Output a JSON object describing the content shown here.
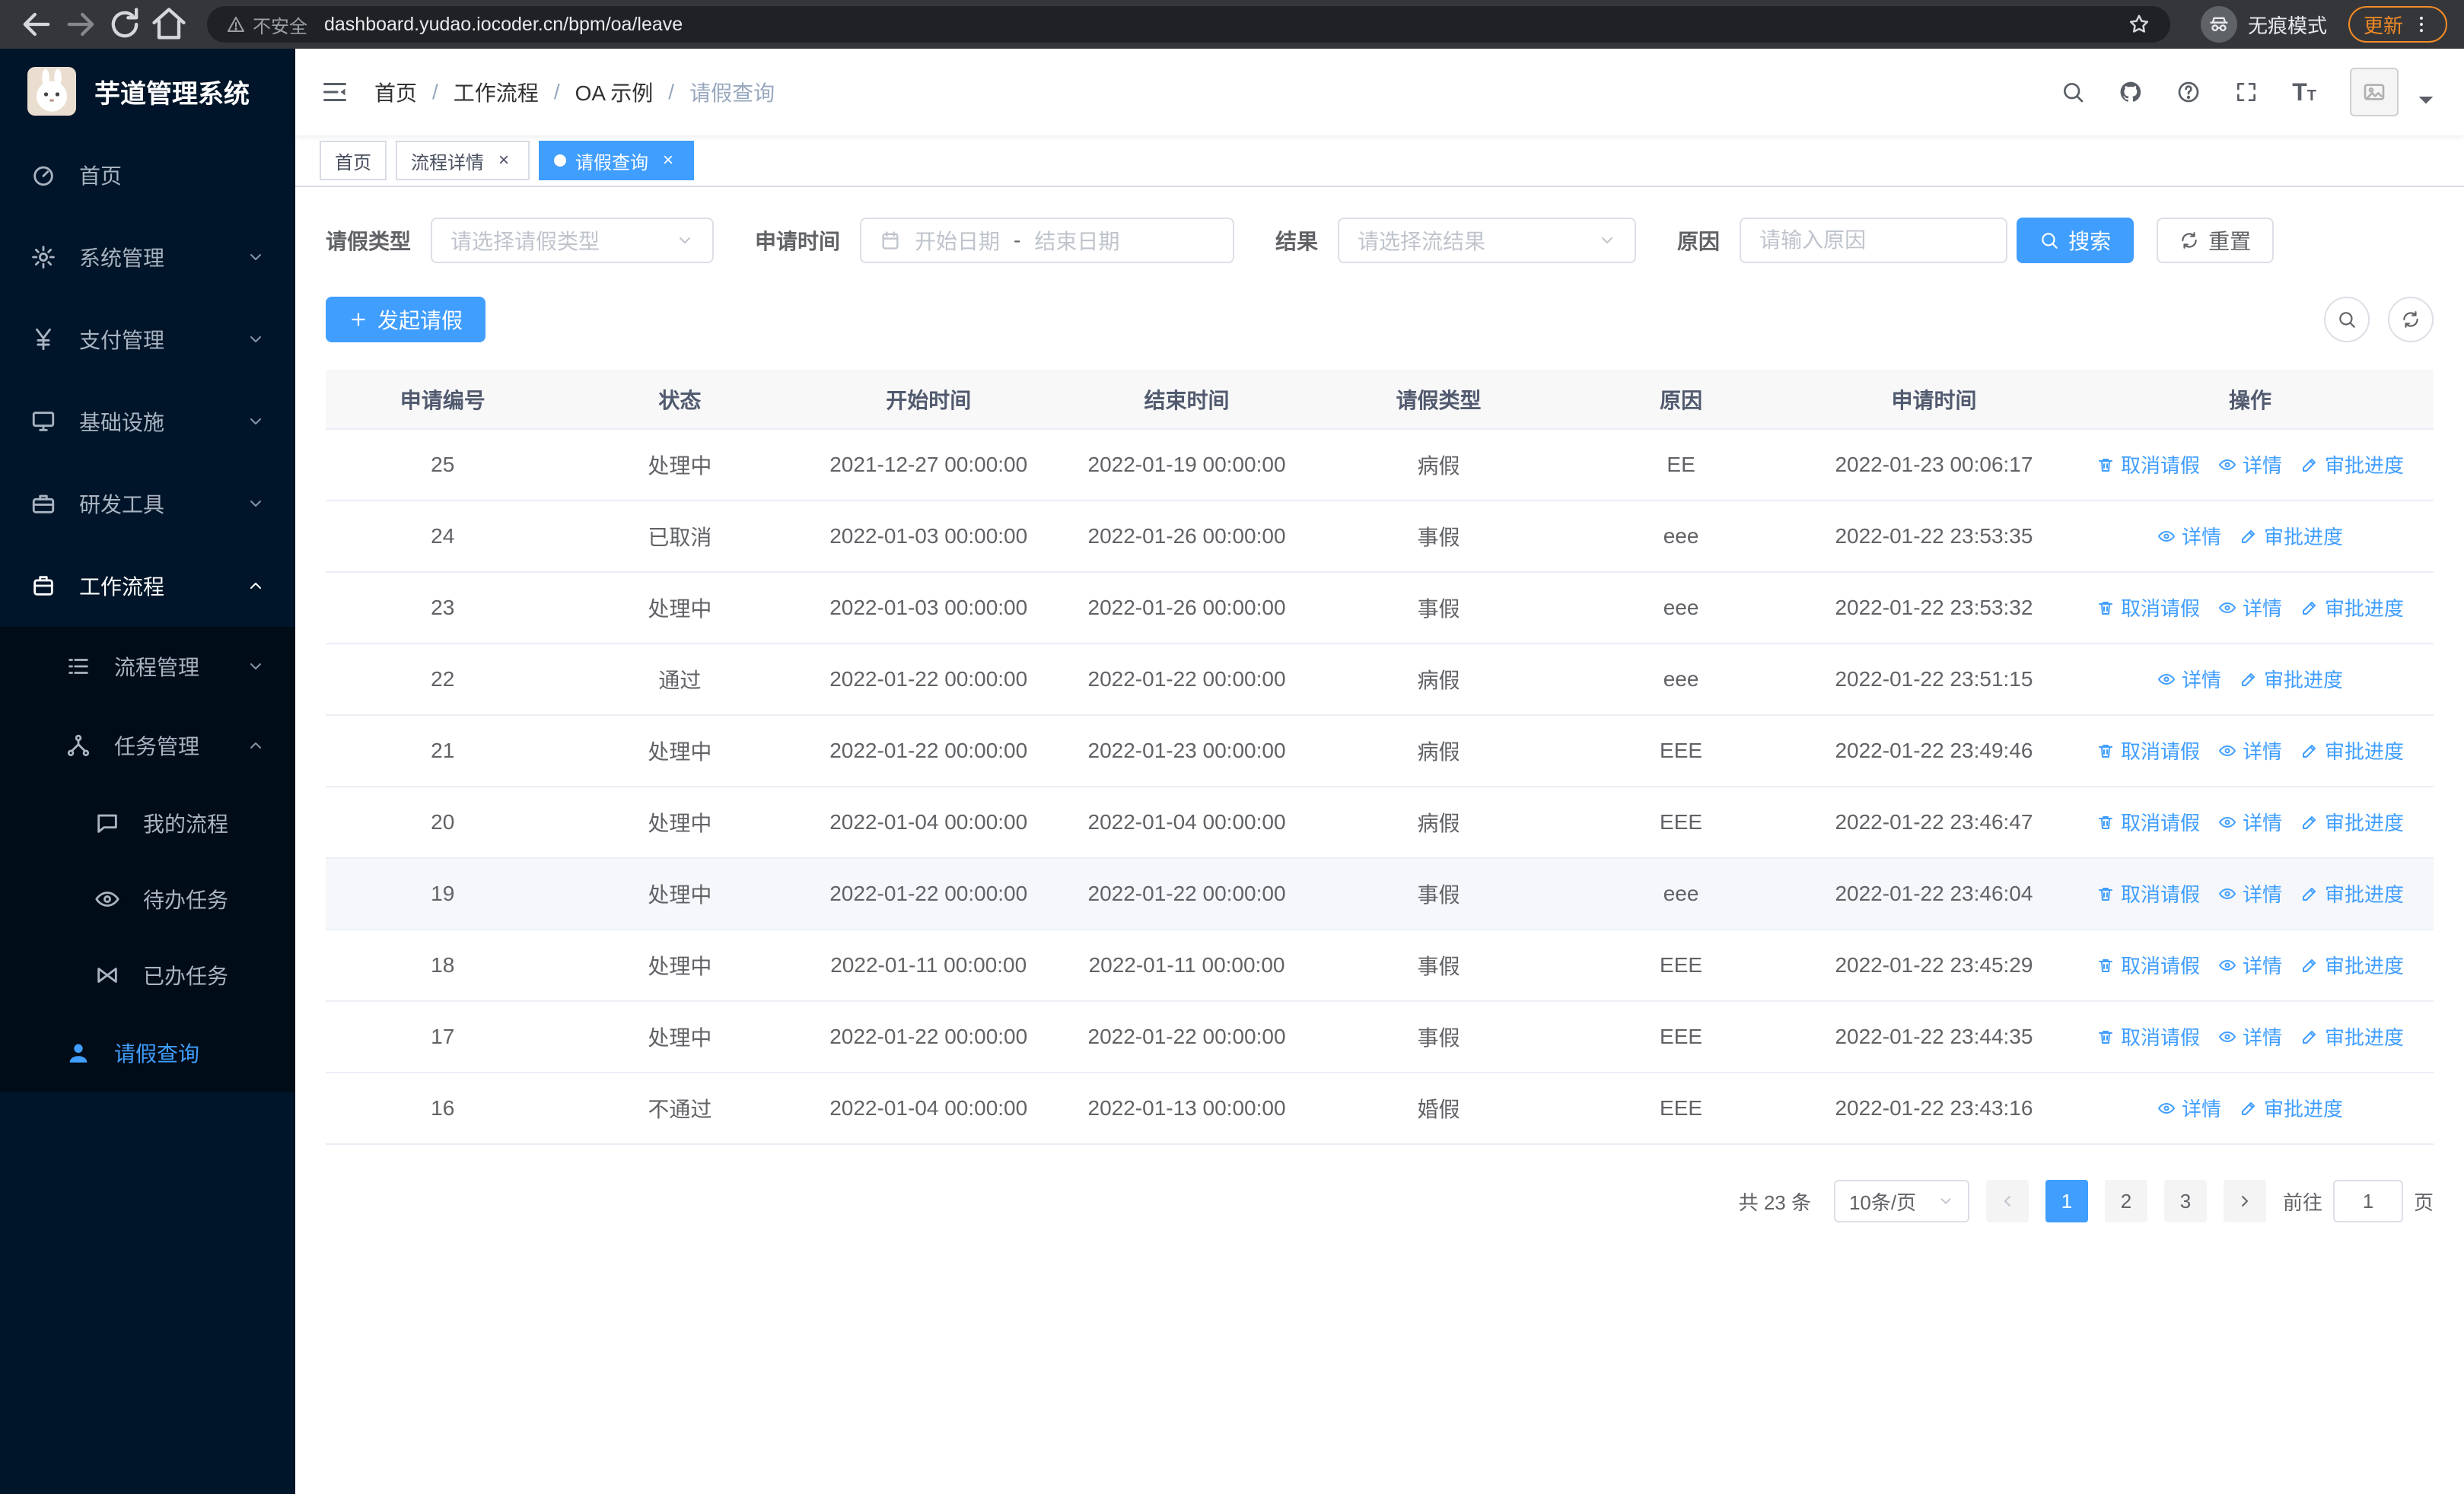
{
  "colors": {
    "accent": "#409eff",
    "sidebar_bg": "#001529",
    "submenu_bg": "#000c17",
    "update_orange": "#f28b25"
  },
  "browser": {
    "security_text": "不安全",
    "url": "dashboard.yudao.iocoder.cn/bpm/oa/leave",
    "incognito_label": "无痕模式",
    "update_label": "更新"
  },
  "sidebar": {
    "logo_title": "芋道管理系统",
    "items": [
      {
        "label": "首页"
      },
      {
        "label": "系统管理"
      },
      {
        "label": "支付管理"
      },
      {
        "label": "基础设施"
      },
      {
        "label": "研发工具"
      },
      {
        "label": "工作流程"
      }
    ],
    "workflow_children": [
      {
        "label": "流程管理"
      },
      {
        "label": "任务管理"
      }
    ],
    "task_children": [
      {
        "label": "我的流程"
      },
      {
        "label": "待办任务"
      },
      {
        "label": "已办任务"
      }
    ],
    "active_item": "请假查询"
  },
  "header": {
    "breadcrumb": [
      "首页",
      "工作流程",
      "OA 示例",
      "请假查询"
    ],
    "separator": "/"
  },
  "tabs": [
    {
      "label": "首页"
    },
    {
      "label": "流程详情"
    },
    {
      "label": "请假查询"
    }
  ],
  "filters": {
    "leave_type_label": "请假类型",
    "leave_type_placeholder": "请选择请假类型",
    "apply_time_label": "申请时间",
    "start_date_placeholder": "开始日期",
    "date_separator": "-",
    "end_date_placeholder": "结束日期",
    "result_label": "结果",
    "result_placeholder": "请选择流结果",
    "reason_label": "原因",
    "reason_placeholder": "请输入原因",
    "search_label": "搜索",
    "reset_label": "重置"
  },
  "toolbar": {
    "create_label": "发起请假"
  },
  "table": {
    "headers": [
      "申请编号",
      "状态",
      "开始时间",
      "结束时间",
      "请假类型",
      "原因",
      "申请时间",
      "操作"
    ],
    "action_defs": {
      "cancel": {
        "label": "取消请假",
        "icon": "trash",
        "name": "cancel-leave-link"
      },
      "detail": {
        "label": "详情",
        "icon": "eye",
        "name": "detail-link"
      },
      "progress": {
        "label": "审批进度",
        "icon": "edit",
        "name": "approval-progress-link"
      }
    },
    "rows": [
      {
        "id": "25",
        "status": "处理中",
        "start": "2021-12-27 00:00:00",
        "end": "2022-01-19 00:00:00",
        "type": "病假",
        "reason": "EE",
        "applied": "2022-01-23 00:06:17",
        "actions": [
          "cancel",
          "detail",
          "progress"
        ],
        "highlighted": false
      },
      {
        "id": "24",
        "status": "已取消",
        "start": "2022-01-03 00:00:00",
        "end": "2022-01-26 00:00:00",
        "type": "事假",
        "reason": "eee",
        "applied": "2022-01-22 23:53:35",
        "actions": [
          "detail",
          "progress"
        ],
        "highlighted": false
      },
      {
        "id": "23",
        "status": "处理中",
        "start": "2022-01-03 00:00:00",
        "end": "2022-01-26 00:00:00",
        "type": "事假",
        "reason": "eee",
        "applied": "2022-01-22 23:53:32",
        "actions": [
          "cancel",
          "detail",
          "progress"
        ],
        "highlighted": false
      },
      {
        "id": "22",
        "status": "通过",
        "start": "2022-01-22 00:00:00",
        "end": "2022-01-22 00:00:00",
        "type": "病假",
        "reason": "eee",
        "applied": "2022-01-22 23:51:15",
        "actions": [
          "detail",
          "progress"
        ],
        "highlighted": false
      },
      {
        "id": "21",
        "status": "处理中",
        "start": "2022-01-22 00:00:00",
        "end": "2022-01-23 00:00:00",
        "type": "病假",
        "reason": "EEE",
        "applied": "2022-01-22 23:49:46",
        "actions": [
          "cancel",
          "detail",
          "progress"
        ],
        "highlighted": false
      },
      {
        "id": "20",
        "status": "处理中",
        "start": "2022-01-04 00:00:00",
        "end": "2022-01-04 00:00:00",
        "type": "病假",
        "reason": "EEE",
        "applied": "2022-01-22 23:46:47",
        "actions": [
          "cancel",
          "detail",
          "progress"
        ],
        "highlighted": false
      },
      {
        "id": "19",
        "status": "处理中",
        "start": "2022-01-22 00:00:00",
        "end": "2022-01-22 00:00:00",
        "type": "事假",
        "reason": "eee",
        "applied": "2022-01-22 23:46:04",
        "actions": [
          "cancel",
          "detail",
          "progress"
        ],
        "highlighted": true
      },
      {
        "id": "18",
        "status": "处理中",
        "start": "2022-01-11 00:00:00",
        "end": "2022-01-11 00:00:00",
        "type": "事假",
        "reason": "EEE",
        "applied": "2022-01-22 23:45:29",
        "actions": [
          "cancel",
          "detail",
          "progress"
        ],
        "highlighted": false
      },
      {
        "id": "17",
        "status": "处理中",
        "start": "2022-01-22 00:00:00",
        "end": "2022-01-22 00:00:00",
        "type": "事假",
        "reason": "EEE",
        "applied": "2022-01-22 23:44:35",
        "actions": [
          "cancel",
          "detail",
          "progress"
        ],
        "highlighted": false
      },
      {
        "id": "16",
        "status": "不通过",
        "start": "2022-01-04 00:00:00",
        "end": "2022-01-13 00:00:00",
        "type": "婚假",
        "reason": "EEE",
        "applied": "2022-01-22 23:43:16",
        "actions": [
          "detail",
          "progress"
        ],
        "highlighted": false
      }
    ]
  },
  "pagination": {
    "total_text": "共 23 条",
    "page_size": "10条/页",
    "pages": [
      "1",
      "2",
      "3"
    ],
    "active_page": "1",
    "goto_prefix": "前往",
    "goto_value": "1",
    "goto_suffix": "页"
  }
}
